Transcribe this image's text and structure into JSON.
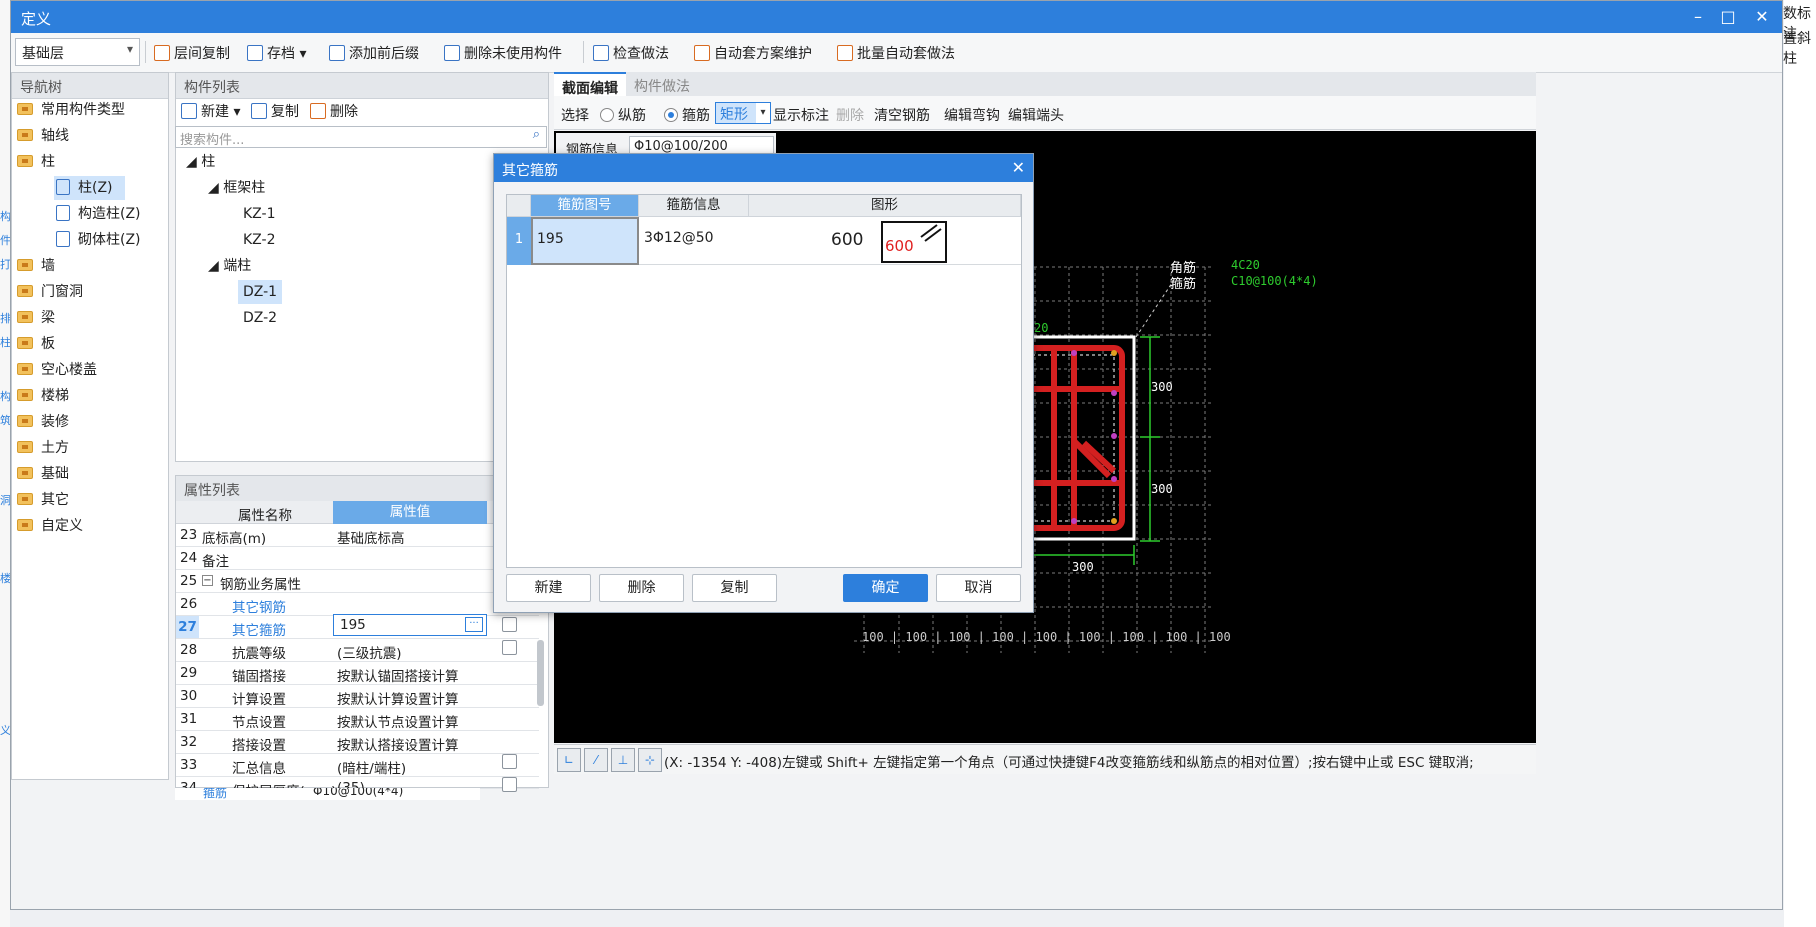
{
  "window": {
    "title": "定义"
  },
  "bg_right_texts": [
    "数标注",
    "置斜柱"
  ],
  "bg_left_chars": [
    "构",
    "件",
    "打",
    "排",
    "柱",
    "构",
    "筑",
    "洞",
    "楼",
    "义"
  ],
  "toolbar": {
    "floor": "基础层",
    "items": [
      "层间复制",
      "存档",
      "添加前后缀",
      "删除未使用构件",
      "检查做法",
      "自动套方案维护",
      "批量自动套做法"
    ]
  },
  "nav": {
    "title": "导航树",
    "items": [
      "常用构件类型",
      "轴线",
      "柱",
      "柱(Z)",
      "构造柱(Z)",
      "砌体柱(Z)",
      "墙",
      "门窗洞",
      "梁",
      "板",
      "空心楼盖",
      "楼梯",
      "装修",
      "土方",
      "基础",
      "其它",
      "自定义"
    ]
  },
  "components": {
    "title": "构件列表",
    "new_label": "新建",
    "copy_label": "复制",
    "delete_label": "删除",
    "search_placeholder": "搜索构件...",
    "tree": [
      "柱",
      "框架柱",
      "KZ-1",
      "KZ-2",
      "端柱",
      "DZ-1",
      "DZ-2"
    ]
  },
  "properties": {
    "title": "属性列表",
    "col_name": "属性名称",
    "col_value": "属性值",
    "rows": [
      {
        "no": "23",
        "name": "底标高(m)",
        "value": "基础底标高"
      },
      {
        "no": "24",
        "name": "备注",
        "value": ""
      },
      {
        "no": "25",
        "name": "钢筋业务属性",
        "value": ""
      },
      {
        "no": "26",
        "name": "其它钢筋",
        "value": ""
      },
      {
        "no": "27",
        "name": "其它箍筋",
        "value": "195"
      },
      {
        "no": "28",
        "name": "抗震等级",
        "value": "(三级抗震)"
      },
      {
        "no": "29",
        "name": "锚固搭接",
        "value": "按默认锚固搭接计算"
      },
      {
        "no": "30",
        "name": "计算设置",
        "value": "按默认计算设置计算"
      },
      {
        "no": "31",
        "name": "节点设置",
        "value": "按默认节点设置计算"
      },
      {
        "no": "32",
        "name": "搭接设置",
        "value": "按默认搭接设置计算"
      },
      {
        "no": "33",
        "name": "汇总信息",
        "value": "(暗柱/端柱)"
      },
      {
        "no": "34",
        "name": "保护层厚度(mm)",
        "value": "(35)"
      }
    ],
    "below_row": {
      "name": "箍筋",
      "value": "Φ10@100(4*4)"
    }
  },
  "editor": {
    "tabs": [
      "截面编辑",
      "构件做法"
    ],
    "tools": {
      "select": "选择",
      "longitudinal": "纵筋",
      "stirrup": "箍筋",
      "shape": "矩形",
      "show_label": "显示标注",
      "delete": "删除",
      "clear": "清空钢筋",
      "edit_hook": "编辑弯钩",
      "edit_end": "编辑端头"
    },
    "rebar_info_label": "钢筋信息",
    "rebar_info_value": "Φ10@100/200",
    "corner_bar_label": "角筋",
    "corner_bar_value": "4C20",
    "stirrup_label": "箍筋",
    "stirrup_value": "C10@100(4*4)",
    "top_label": "20",
    "dim_right": [
      "300",
      "300"
    ],
    "dim_bottom": "300",
    "grid_label": "100",
    "status_text": "(X: -1354 Y: -408)左键或 Shift+ 左键指定第一个角点（可通过快捷键F4改变箍筋线和纵筋点的相对位置）;按右键中止或 ESC 键取消;"
  },
  "dialog": {
    "title": "其它箍筋",
    "headers": [
      "箍筋图号",
      "箍筋信息",
      "图形"
    ],
    "row": {
      "no": "1",
      "code": "195",
      "info": "3Φ12@50",
      "shape_value": "600",
      "shape_label": "600"
    },
    "buttons": {
      "new": "新建",
      "delete": "删除",
      "copy": "复制",
      "ok": "确定",
      "cancel": "取消"
    }
  }
}
